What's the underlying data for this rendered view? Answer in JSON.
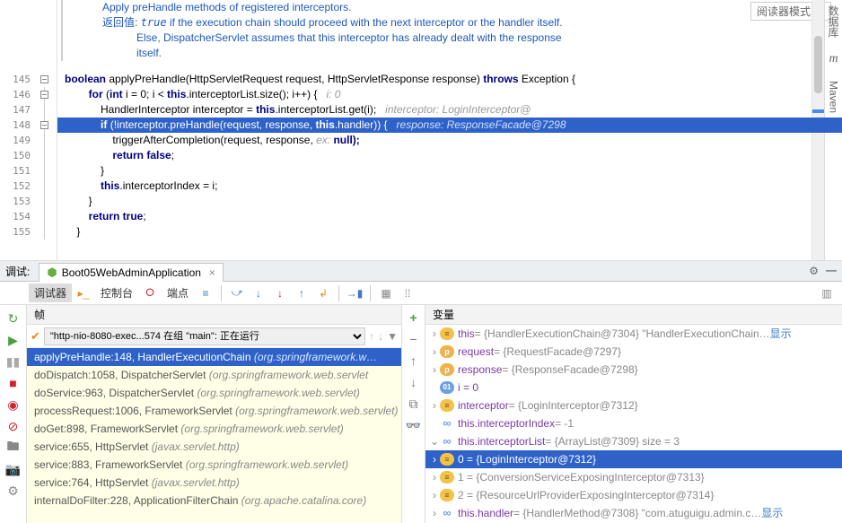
{
  "reader_mode": "阅读器模式",
  "right_tabs": {
    "db": "数据库",
    "maven": "Maven"
  },
  "doc": {
    "l1": "Apply preHandle methods of registered interceptors.",
    "ret": "返回值:",
    "true": "true",
    "l2": " if the execution chain should proceed with the next interceptor or the handler itself.",
    "l3": "Else, DispatcherServlet assumes that this interceptor has already dealt with the response",
    "l4": "itself."
  },
  "lines": {
    "n145": "145",
    "n146": "146",
    "n147": "147",
    "n148": "148",
    "n149": "149",
    "n150": "150",
    "n151": "151",
    "n152": "152",
    "n153": "153",
    "n154": "154",
    "n155": "155"
  },
  "code": {
    "l145a": "boolean",
    "l145b": " applyPreHandle(HttpServletRequest request, HttpServletResponse response) ",
    "l145c": "throws",
    "l145d": " Exception {",
    "l146a": "for",
    "l146b": " (",
    "l146c": "int",
    "l146d": " i = 0; i < ",
    "l146e": "this",
    "l146f": ".interceptorList.size(); i++) {   ",
    "l146g": "i: 0",
    "l147a": "HandlerInterceptor interceptor = ",
    "l147b": "this",
    "l147c": ".interceptorList.get(i);   ",
    "l147d": "interceptor: LoginInterceptor@",
    "l148a": "if",
    "l148b": " (!interceptor.preHandle(request, response, ",
    "l148c": "this",
    "l148d": ".handler)) {   ",
    "l148e": "response: ResponseFacade@7298",
    "l149a": "triggerAfterCompletion(request, response, ",
    "l149b": "ex:",
    "l149c": " null);",
    "l150a": "return false",
    ";": ";",
    "l151": "}",
    "l152a": "this",
    "l152b": ".interceptorIndex = i;",
    "l153": "}",
    "l154a": "return true",
    ";2": ";",
    "l155": "}"
  },
  "debug": {
    "tabLabel": "调试:",
    "appTab": "Boot05WebAdminApplication",
    "debugger": "调试器",
    "console": "控制台",
    "threads": "端点",
    "framesHdr": "帧",
    "varsHdr": "变量",
    "threadSel": "\"http-nio-8080-exec...574 在组 \"main\": 正在运行"
  },
  "stack": {
    "f0a": "applyPreHandle:148, HandlerExecutionChain ",
    "f0b": "(org.springframework.w…",
    "f1a": "doDispatch:1058, DispatcherServlet ",
    "f1b": "(org.springframework.web.servlet",
    "f2a": "doService:963, DispatcherServlet ",
    "f2b": "(org.springframework.web.servlet)",
    "f3a": "processRequest:1006, FrameworkServlet ",
    "f3b": "(org.springframework.web.servlet)",
    "f4a": "doGet:898, FrameworkServlet ",
    "f4b": "(org.springframework.web.servlet)",
    "f5a": "service:655, HttpServlet ",
    "f5b": "(javax.servlet.http)",
    "f6a": "service:883, FrameworkServlet ",
    "f6b": "(org.springframework.web.servlet)",
    "f7a": "service:764, HttpServlet ",
    "f7b": "(javax.servlet.http)",
    "f8a": "internalDoFilter:228, ApplicationFilterChain ",
    "f8b": "(org.apache.catalina.core)"
  },
  "vars": {
    "this_name": "this",
    "this_val": " = {HandlerExecutionChain@7304} \"HandlerExecutionChain…",
    "show": "显示",
    "req_name": "request",
    "req_val": " = {RequestFacade@7297}",
    "res_name": "response",
    "res_val": " = {ResponseFacade@7298}",
    "i_name": " i = 0",
    "int_name": "interceptor",
    "int_val": " = {LoginInterceptor@7312}",
    "idx_name": "this.interceptorIndex",
    "idx_val": " = -1",
    "list_name": "this.interceptorList",
    "list_val": " = {ArrayList@7309}  size = 3",
    "e0": " 0 = {LoginInterceptor@7312}",
    "e1": " 1 = {ConversionServiceExposingInterceptor@7313}",
    "e2": " 2 = {ResourceUrlProviderExposingInterceptor@7314}",
    "h_name": "this.handler",
    "h_val": " = {HandlerMethod@7308} \"com.atuguigu.admin.c…"
  }
}
